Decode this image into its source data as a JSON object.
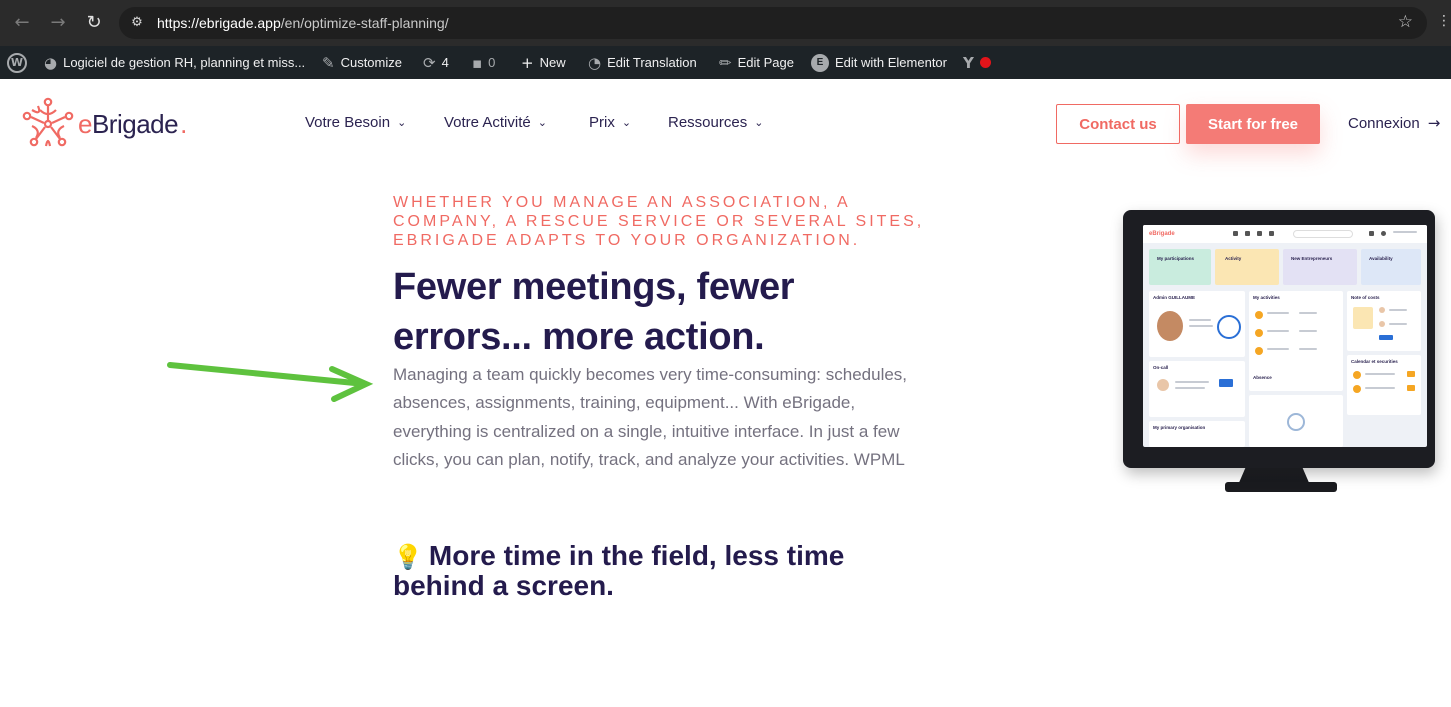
{
  "browser": {
    "url_host": "https://ebrigade.app",
    "url_path": "/en/optimize-staff-planning/",
    "icons": [
      "back-icon",
      "forward-icon",
      "reload-icon",
      "site-info-icon",
      "bookmark-star-icon"
    ]
  },
  "wp_admin_bar": {
    "site_name": "Logiciel de gestion RH, planning et miss...",
    "customize": "Customize",
    "updates_count": "4",
    "comments_count": "0",
    "new": "New",
    "edit_translation": "Edit Translation",
    "edit_page": "Edit Page",
    "edit_with_elementor": "Edit with Elementor",
    "status_dot_color": "#e3141a"
  },
  "header": {
    "logo_text": "eBrigade",
    "nav": [
      {
        "label": "Votre Besoin"
      },
      {
        "label": "Votre Activité"
      },
      {
        "label": "Prix"
      },
      {
        "label": "Ressources"
      }
    ],
    "contact_label": "Contact us",
    "start_label": "Start for free",
    "connexion_label": "Connexion",
    "accent_color": "#f06a63",
    "text_color": "#2b2350"
  },
  "hero": {
    "kicker": "Whether you manage an association, a company, a rescue service or several sites, eBrigade adapts to your organization.",
    "title": "Fewer meetings, fewer errors... more action.",
    "body": "Managing a team quickly becomes very time-consuming: schedules, absences, assignments, training, equipment... With eBrigade, everything is centralized on a single, intuitive interface. In just a few clicks, you can plan, notify, track, and analyze your activities. WPML",
    "subtitle": "More time in the field, less time behind a screen.",
    "subtitle_icon": "lightbulb-icon",
    "arrow_color": "#5ec23e"
  },
  "monitor_screen": {
    "logo": "eBrigade",
    "cards": [
      {
        "label": "My participations",
        "color": "#c9ecde"
      },
      {
        "label": "Activity",
        "color": "#fbe6b3"
      },
      {
        "label": "New Entrepreneurs",
        "color": "#e3e1f4"
      },
      {
        "label": "Availability",
        "color": "#dde7f7"
      }
    ],
    "admin_label": "Admin GUILLAUME",
    "activities_label": "My activities",
    "notes_label": "Note of costs",
    "oncall_label": "On-call",
    "absence_label": "Absence",
    "calendar_label": "Calendar et securities",
    "organisation_label": "My primary organisation"
  }
}
